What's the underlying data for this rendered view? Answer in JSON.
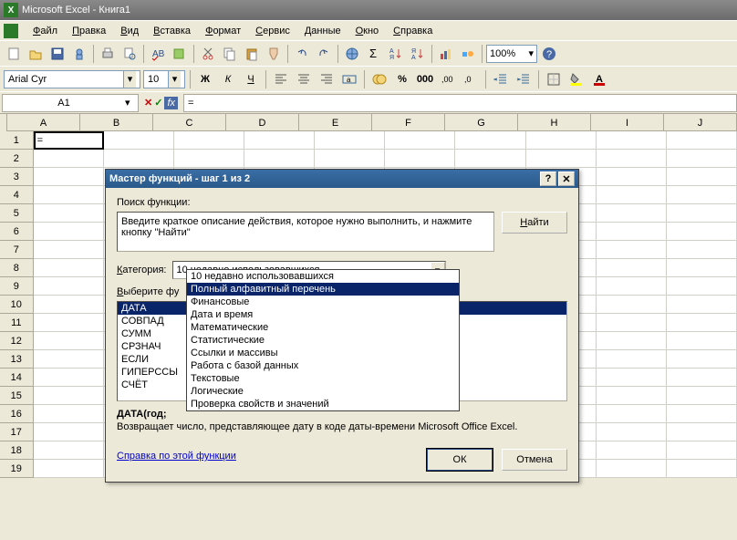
{
  "title": "Microsoft Excel - Книга1",
  "menus": [
    "Файл",
    "Правка",
    "Вид",
    "Вставка",
    "Формат",
    "Сервис",
    "Данные",
    "Окно",
    "Справка"
  ],
  "font_name": "Arial Cyr",
  "font_size": "10",
  "zoom": "100%",
  "namebox": "A1",
  "formula_bar": "=",
  "cell_a1": "=",
  "columns": [
    "A",
    "B",
    "C",
    "D",
    "E",
    "F",
    "G",
    "H",
    "I",
    "J"
  ],
  "rows": [
    "1",
    "2",
    "3",
    "4",
    "5",
    "6",
    "7",
    "8",
    "9",
    "10",
    "11",
    "12",
    "13",
    "14",
    "15",
    "16",
    "17",
    "18",
    "19"
  ],
  "dialog": {
    "title": "Мастер функций - шаг 1 из 2",
    "search_label": "Поиск функции:",
    "search_text": "Введите краткое описание действия, которое нужно выполнить, и нажмите кнопку \"Найти\"",
    "find_btn": "Найти",
    "category_label": "Категория:",
    "category_value": "10 недавно использовавшихся",
    "choose_label": "Выберите фу",
    "functions": [
      "ДАТА",
      "СОВПАД",
      "СУММ",
      "СРЗНАЧ",
      "ЕСЛИ",
      "ГИПЕРССЫ",
      "СЧЁТ"
    ],
    "syntax": "ДАТА(год;",
    "description": "Возвращает число, представляющее дату в коде даты-времени Microsoft Office Excel.",
    "help_link": "Справка по этой функции",
    "ok": "ОК",
    "cancel": "Отмена"
  },
  "dropdown": {
    "options": [
      "10 недавно использовавшихся",
      "Полный алфавитный перечень",
      "Финансовые",
      "Дата и время",
      "Математические",
      "Статистические",
      "Ссылки и массивы",
      "Работа с базой данных",
      "Текстовые",
      "Логические",
      "Проверка свойств и значений"
    ],
    "selected_index": 1
  }
}
